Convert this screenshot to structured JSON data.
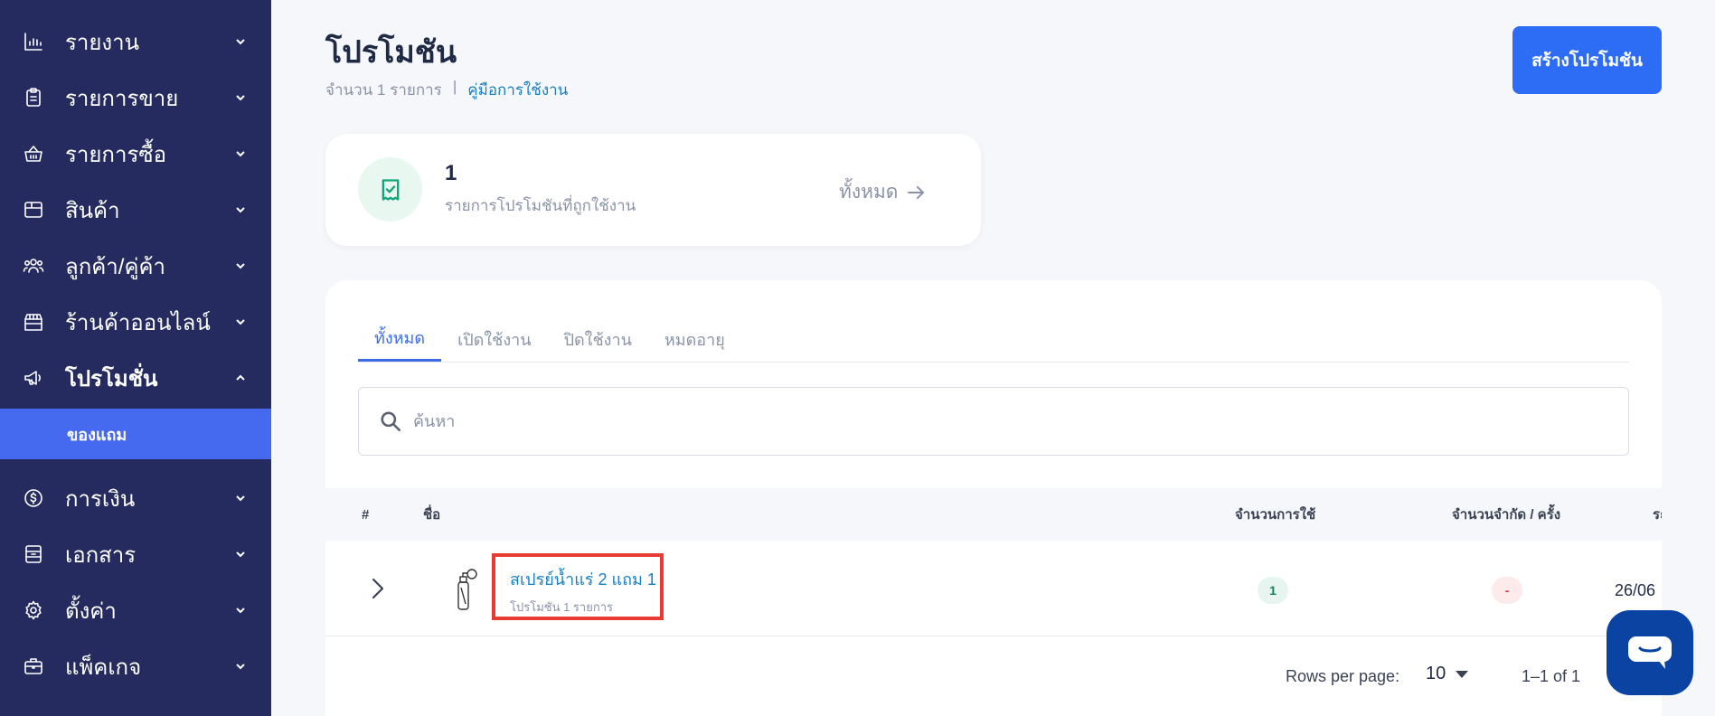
{
  "sidebar": {
    "items": [
      {
        "label": "รายงาน",
        "icon": "bar-chart-icon"
      },
      {
        "label": "รายการขาย",
        "icon": "clipboard-icon"
      },
      {
        "label": "รายการซื้อ",
        "icon": "basket-icon"
      },
      {
        "label": "สินค้า",
        "icon": "box-icon"
      },
      {
        "label": "ลูกค้า/คู่ค้า",
        "icon": "users-icon"
      },
      {
        "label": "ร้านค้าออนไลน์",
        "icon": "store-icon"
      },
      {
        "label": "โปรโมชั่น",
        "icon": "megaphone-icon"
      },
      {
        "label": "การเงิน",
        "icon": "dollar-circle-icon"
      },
      {
        "label": "เอกสาร",
        "icon": "document-icon"
      },
      {
        "label": "ตั้งค่า",
        "icon": "gear-icon"
      },
      {
        "label": "แพ็คเกจ",
        "icon": "briefcase-icon"
      }
    ],
    "active_sub_item": "ของแถม"
  },
  "header": {
    "title": "โปรโมชัน",
    "count_text": "จำนวน 1 รายการ",
    "separator": "|",
    "guide_link": "คู่มือการใช้งาน",
    "create_button": "สร้างโปรโมชัน"
  },
  "summary": {
    "count": "1",
    "description": "รายการโปรโมชันที่ถูกใช้งาน",
    "all_link": "ทั้งหมด",
    "icon": "receipt-check-icon"
  },
  "tabs": [
    "ทั้งหมด",
    "เปิดใช้งาน",
    "ปิดใช้งาน",
    "หมดอายุ"
  ],
  "active_tab": "ทั้งหมด",
  "search": {
    "placeholder": "ค้นหา",
    "value": ""
  },
  "table": {
    "columns": [
      "#",
      "ชื่อ",
      "จำนวนการใช้",
      "จำนวนจำกัด / ครั้ง",
      "ระ"
    ],
    "rows": [
      {
        "name": "สเปรย์น้ำแร่ 2 แถม 1",
        "subtitle": "โปรโมชัน 1 รายการ",
        "usage": "1",
        "limit": "-",
        "date": "26/06"
      }
    ]
  },
  "pagination": {
    "rows_label": "Rows per page:",
    "rows_value": "10",
    "range": "1–1 of 1"
  },
  "colors": {
    "sidebar_bg": "#252b5e",
    "active_sub_bg": "#4569ef",
    "primary": "#2d6df6",
    "link": "#1a7fc1",
    "highlight_border": "#e63a32",
    "chat_bg": "#0b43a3"
  }
}
